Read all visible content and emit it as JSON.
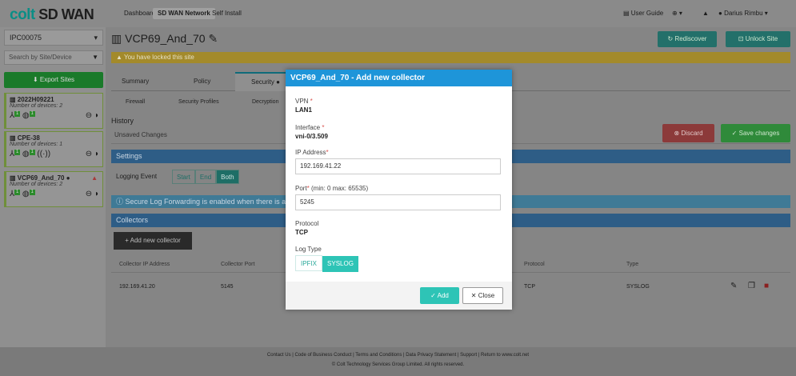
{
  "brand": {
    "logo_c": "colt",
    "logo_rest": " SD WAN"
  },
  "nav": {
    "dashboard": "Dashboard",
    "sdwan": "SD WAN Network",
    "selfinstall": "Self Install",
    "guide": "User Guide",
    "user": "Darius Rimbu"
  },
  "sidebar": {
    "selected": "IPC00075",
    "search_placeholder": "Search by Site/Device",
    "export": "Export Sites",
    "sites": [
      {
        "name": "2022H09221",
        "devices": "Number of devices: 2"
      },
      {
        "name": "CPE-38",
        "devices": "Number of devices: 1"
      },
      {
        "name": "VCP69_And_70",
        "devices": "Number of devices: 2"
      }
    ]
  },
  "page": {
    "title": "VCP69_And_70",
    "rediscover": "Rediscover",
    "unlock": "Unlock Site",
    "warning": "You have locked this site",
    "tabs": [
      "Summary",
      "Policy",
      "Security"
    ],
    "subtabs": [
      "Firewall",
      "Security Profiles",
      "Decryption"
    ],
    "history": "History",
    "unsaved": "Unsaved Changes",
    "discard": "Discard",
    "save": "Save changes",
    "settings": "Settings",
    "logging_event": "Logging Event",
    "seg": [
      "Start",
      "End",
      "Both"
    ],
    "info": "Secure Log Forwarding is enabled when there is a",
    "collectors": "Collectors",
    "add_collector": "+ Add new collector",
    "table_headers": [
      "Collector IP Address",
      "Collector Port",
      "Protocol",
      "Type"
    ],
    "rows": [
      {
        "ip": "192.169.41.20",
        "port": "5145",
        "protocol": "TCP",
        "type": "SYSLOG"
      }
    ]
  },
  "modal": {
    "title": "VCP69_And_70 - Add new collector",
    "vpn_label": "VPN",
    "vpn_value": "LAN1",
    "iface_label": "Interface",
    "iface_value": "vni-0/3.509",
    "ip_label": "IP Address",
    "ip_value": "192.169.41.22",
    "port_label": "Port",
    "port_hint": " (min: 0 max: 65535)",
    "port_value": "5245",
    "proto_label": "Protocol",
    "proto_value": "TCP",
    "logtype_label": "Log Type",
    "logtype_opts": [
      "IPFIX",
      "SYSLOG"
    ],
    "add": "Add",
    "close": "Close"
  },
  "footer": {
    "links": "Contact Us | Code of Business Conduct | Terms and Conditions | Data Privacy Statement | Support | Return to www.colt.net",
    "copyright": "© Colt Technology Services Group Limited. All rights reserved."
  }
}
